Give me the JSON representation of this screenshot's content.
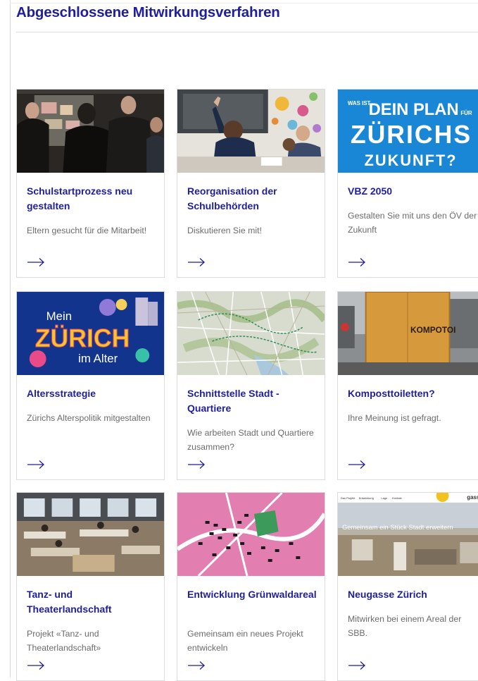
{
  "page": {
    "title": "Abgeschlossene Mitwirkungsverfahren"
  },
  "colors": {
    "accent": "#1f1f9e",
    "text_muted": "#6b6b6b",
    "border": "#dcdcdc"
  },
  "cards": [
    {
      "title": "Schulstartprozess neu gestalten",
      "description": "Eltern gesucht für die Mitarbeit!",
      "image": "photo-workshop-people-at-pinboard",
      "arrow_icon": "arrow-right-icon"
    },
    {
      "title": "Reorganisation der Schulbehörden",
      "description": "Diskutieren Sie mit!",
      "image": "photo-classroom-children",
      "arrow_icon": "arrow-right-icon"
    },
    {
      "title": "VBZ 2050",
      "description": "Gestalten Sie mit uns den ÖV der Zukunft",
      "image": "poster-was-ist-dein-plan",
      "image_text": {
        "line1_small_left": "WAS IST",
        "line1": "DEIN PLAN",
        "line1_small_right": "FÜR",
        "line2": "ZÜRICHS",
        "line3": "ZUKUNFT?"
      },
      "arrow_icon": "arrow-right-icon"
    },
    {
      "title": "Altersstrategie",
      "description": "Zürichs Alterspolitik mitgestalten",
      "image": "poster-mein-zuerich-im-alter",
      "image_text": {
        "line1": "Mein",
        "line2": "ZÜRICH",
        "line3": "im Alter"
      },
      "arrow_icon": "arrow-right-icon"
    },
    {
      "title": "Schnittstelle Stadt - Quartiere",
      "description": "Wie arbeiten Stadt und Quartiere zusammen?",
      "image": "map-city-quarters",
      "arrow_icon": "arrow-right-icon"
    },
    {
      "title": "Komposttoiletten?",
      "description": "Ihre Meinung ist gefragt.",
      "image": "photo-compost-toilet",
      "image_text": {
        "sign": "KOMPOTOI"
      },
      "arrow_icon": "arrow-right-icon"
    },
    {
      "title": "Tanz- und Theaterlandschaft",
      "description": "Projekt «Tanz- und Theaterlandschaft»",
      "image": "photo-workshop-hall-tables",
      "arrow_icon": "arrow-right-icon"
    },
    {
      "title": "Entwicklung Grünwaldareal",
      "description": "Gemeinsam ein neues Projekt entwickeln",
      "image": "map-gruenwald-area",
      "arrow_icon": "arrow-right-icon"
    },
    {
      "title": "Neugasse Zürich",
      "description": "Mitwirken bei einem Areal der SBB.",
      "image": "website-screenshot-neugasse",
      "image_text": {
        "nav": [
          "Das Projekt",
          "Entwicklung",
          "Lage",
          "Kontakt"
        ],
        "headline": "Gemeinsam ein Stück Stadt erweitern",
        "logo": "gasse"
      },
      "arrow_icon": "arrow-right-icon"
    }
  ]
}
